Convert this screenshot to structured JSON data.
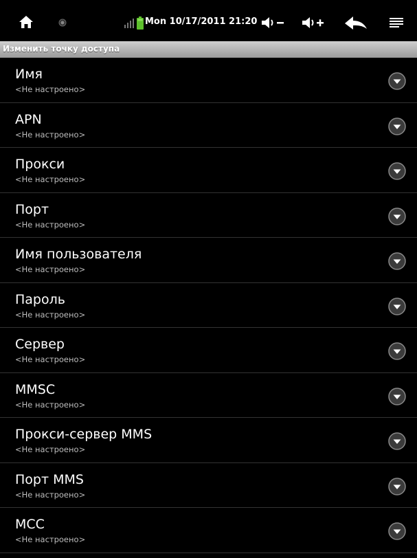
{
  "status_bar": {
    "clock": "Mon 10/17/2011 21:20",
    "icons": [
      "home-icon",
      "notification-dot-icon",
      "signal-icon",
      "battery-icon",
      "volume-down-icon",
      "volume-up-icon",
      "back-icon",
      "menu-icon"
    ]
  },
  "title_bar": {
    "title": "Изменить точку доступа"
  },
  "list": {
    "items": [
      {
        "title": "Имя",
        "summary": "<Не настроено>"
      },
      {
        "title": "APN",
        "summary": "<Не настроено>"
      },
      {
        "title": "Прокси",
        "summary": "<Не настроено>"
      },
      {
        "title": "Порт",
        "summary": "<Не настроено>"
      },
      {
        "title": "Имя пользователя",
        "summary": "<Не настроено>"
      },
      {
        "title": "Пароль",
        "summary": "<Не настроено>"
      },
      {
        "title": "Сервер",
        "summary": "<Не настроено>"
      },
      {
        "title": "MMSC",
        "summary": "<Не настроено>"
      },
      {
        "title": "Прокси-сервер MMS",
        "summary": "<Не настроено>"
      },
      {
        "title": "Порт MMS",
        "summary": "<Не настроено>"
      },
      {
        "title": "MCC",
        "summary": "<Не настроено>"
      }
    ]
  },
  "colors": {
    "background": "#000000",
    "title_bar": "#b5b5b5",
    "battery": "#5ec12d",
    "summary_text": "#bdbdbd"
  }
}
